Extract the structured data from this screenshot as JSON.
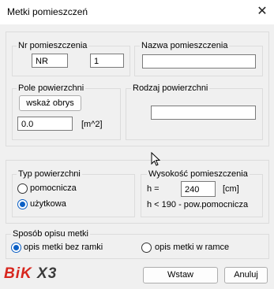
{
  "window": {
    "title": "Metki pomieszczeń",
    "close_glyph": "✕"
  },
  "room_number": {
    "label": "Nr pomieszczenia",
    "prefix_value": "NR",
    "number_value": "1"
  },
  "room_name": {
    "label": "Nazwa pomieszczenia",
    "value": ""
  },
  "area": {
    "label": "Pole powierzchni",
    "outline_button": "wskaż obrys",
    "value": "0.0",
    "unit": "[m^2]"
  },
  "surface_type_box": {
    "label": "Rodzaj powierzchni",
    "value": ""
  },
  "area_kind": {
    "label": "Typ powierzchni",
    "options": [
      {
        "label": "pomocnicza",
        "checked": false
      },
      {
        "label": "użytkowa",
        "checked": true
      }
    ]
  },
  "height": {
    "label": "Wysokość pomieszczenia",
    "h_label": "h =",
    "value": "240",
    "unit": "[cm]",
    "note": "h < 190 - pow.pomocnicza"
  },
  "label_style": {
    "label": "Sposób opisu metki",
    "options": [
      {
        "label": "opis metki bez ramki",
        "checked": true
      },
      {
        "label": "opis metki w ramce",
        "checked": false
      }
    ]
  },
  "footer": {
    "logo_text": "BiK",
    "logo_suffix": "X3",
    "insert_button": "Wstaw",
    "cancel_button": "Anuluj"
  },
  "colors": {
    "accent": "#0b5fc5",
    "logo_red": "#d7261e"
  },
  "icons": {
    "close": "close-icon",
    "cursor": "mouse-cursor-icon"
  }
}
